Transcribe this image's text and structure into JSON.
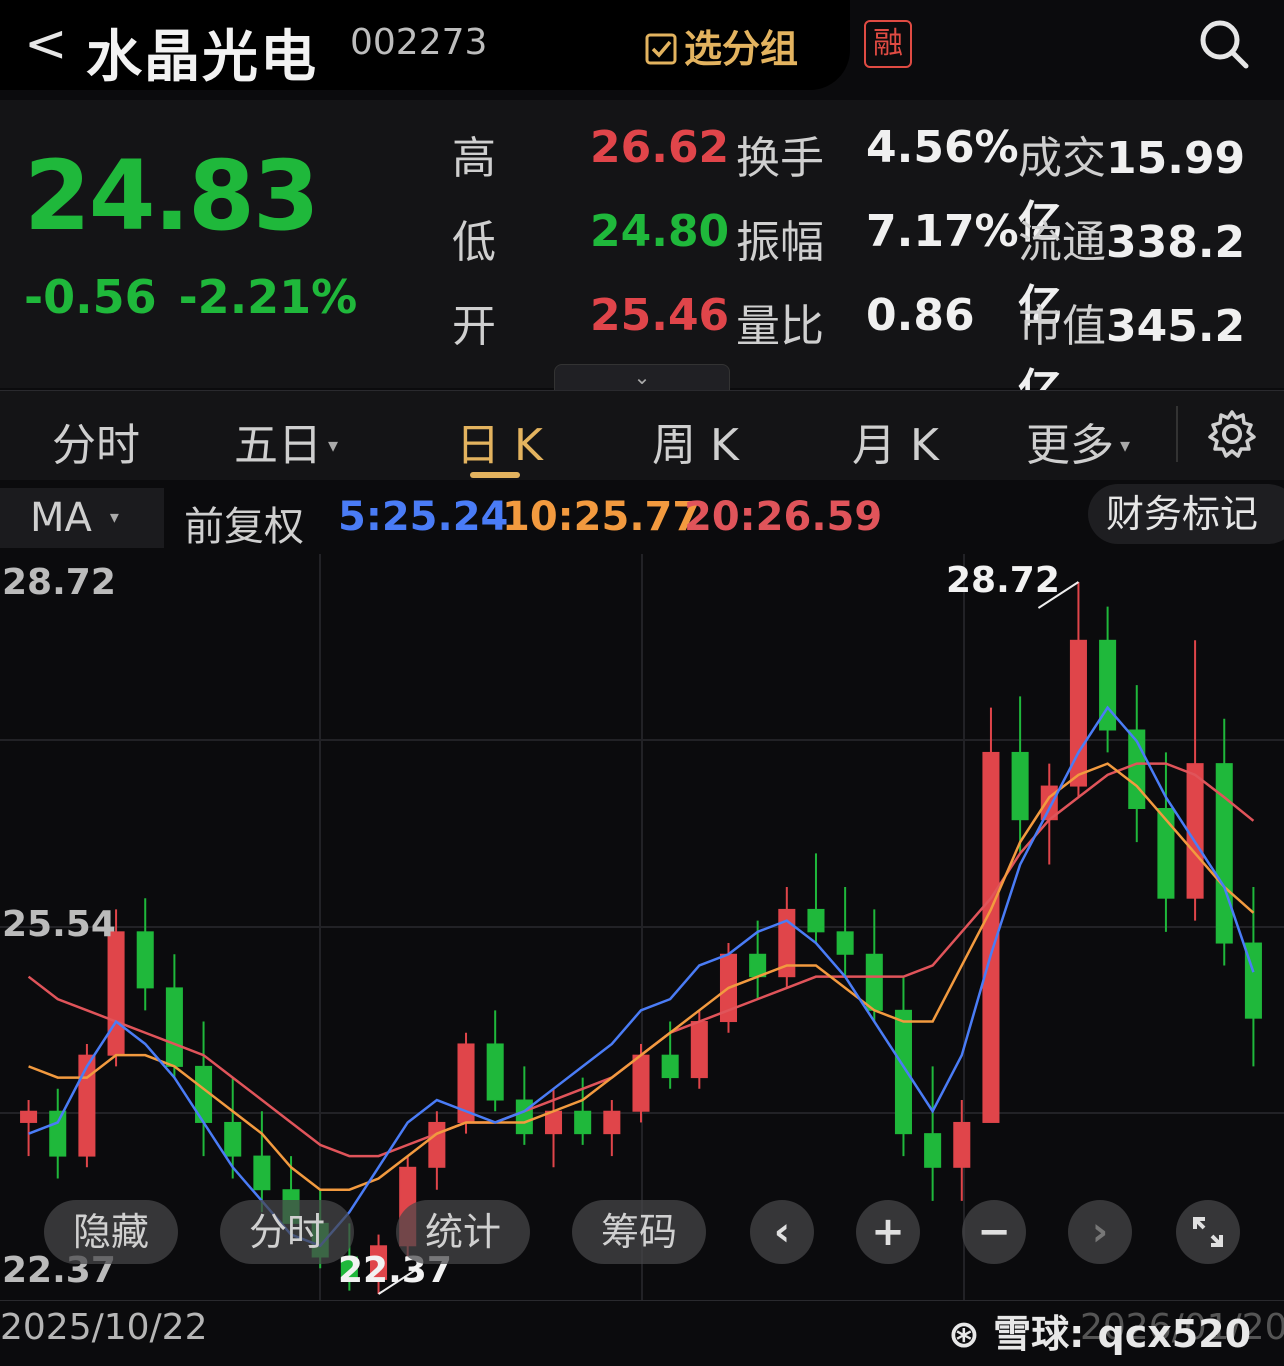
{
  "header": {
    "back_glyph": "<",
    "stock_name": "水晶光电",
    "stock_code": "002273",
    "pick_group": "选分组",
    "margin_badge": "融"
  },
  "quote": {
    "price": "24.83",
    "change": "-0.56",
    "change_pct": "-2.21%",
    "rows": [
      {
        "k1": "高",
        "v1": "26.62",
        "v1_color": "red",
        "k2": "换手",
        "v2": "4.56%",
        "k3": "成交",
        "v3": "15.99亿"
      },
      {
        "k1": "低",
        "v1": "24.80",
        "v1_color": "green",
        "k2": "振幅",
        "v2": "7.17%",
        "k3": "流通",
        "v3": "338.2亿"
      },
      {
        "k1": "开",
        "v1": "25.46",
        "v1_color": "red",
        "k2": "量比",
        "v2": "0.86",
        "k3": "市值",
        "v3": "345.2亿"
      }
    ]
  },
  "tabs": {
    "fenshi": "分时",
    "wuri": "五日",
    "rik": "日 K",
    "zhouk": "周 K",
    "yuek": "月 K",
    "more": "更多",
    "caret": "▾"
  },
  "ma_bar": {
    "select": "MA",
    "fuquan": "前复权",
    "ma5": "5:25.24",
    "ma10": "10:25.77",
    "ma20": "20:26.59",
    "fin_mark": "财务标记"
  },
  "chart_axis": {
    "y_top": "28.72",
    "y_mid": "25.54",
    "y_bottom": "22.37",
    "max_label": "28.72",
    "min_label": "22.37",
    "x_start": "2025/10/22"
  },
  "controls": {
    "hide": "隐藏",
    "fenshi": "分时",
    "stats": "统计",
    "chips": "筹码",
    "prev": "‹",
    "zoom_in": "+",
    "zoom_out": "−",
    "next": "›"
  },
  "watermark": {
    "text": "雪球: qcx520",
    "date_end": "2026/01/20"
  },
  "colors": {
    "up": "#e0454a",
    "down": "#1fb83b",
    "ma5": "#4a7cf6",
    "ma10": "#f29a3f",
    "ma20": "#e0545a",
    "accent": "#e3b35f"
  },
  "chart_data": {
    "type": "candlestick",
    "y_range": [
      22.37,
      28.72
    ],
    "x_start": "2025/10/22",
    "candles": [
      [
        23.9,
        24.1,
        23.6,
        24.0
      ],
      [
        24.0,
        24.2,
        23.4,
        23.6
      ],
      [
        23.6,
        24.6,
        23.5,
        24.5
      ],
      [
        24.5,
        25.8,
        24.4,
        25.6
      ],
      [
        25.6,
        25.9,
        24.9,
        25.1
      ],
      [
        25.1,
        25.4,
        24.3,
        24.4
      ],
      [
        24.4,
        24.8,
        23.6,
        23.9
      ],
      [
        23.9,
        24.3,
        23.4,
        23.6
      ],
      [
        23.6,
        24.0,
        23.1,
        23.3
      ],
      [
        23.3,
        23.6,
        22.9,
        23.0
      ],
      [
        23.0,
        23.3,
        22.6,
        22.7
      ],
      [
        22.7,
        23.0,
        22.4,
        22.5
      ],
      [
        22.5,
        22.9,
        22.37,
        22.8
      ],
      [
        22.8,
        23.6,
        22.7,
        23.5
      ],
      [
        23.5,
        24.0,
        23.3,
        23.9
      ],
      [
        23.9,
        24.7,
        23.8,
        24.6
      ],
      [
        24.6,
        24.9,
        24.0,
        24.1
      ],
      [
        24.1,
        24.4,
        23.7,
        23.8
      ],
      [
        23.8,
        24.2,
        23.5,
        24.0
      ],
      [
        24.0,
        24.3,
        23.7,
        23.8
      ],
      [
        23.8,
        24.1,
        23.6,
        24.0
      ],
      [
        24.0,
        24.6,
        23.9,
        24.5
      ],
      [
        24.5,
        24.8,
        24.2,
        24.3
      ],
      [
        24.3,
        24.9,
        24.2,
        24.8
      ],
      [
        24.8,
        25.5,
        24.7,
        25.4
      ],
      [
        25.4,
        25.7,
        25.0,
        25.2
      ],
      [
        25.2,
        26.0,
        25.1,
        25.8
      ],
      [
        25.8,
        26.3,
        25.5,
        25.6
      ],
      [
        25.6,
        26.0,
        25.2,
        25.4
      ],
      [
        25.4,
        25.8,
        24.8,
        24.9
      ],
      [
        24.9,
        25.2,
        23.6,
        23.8
      ],
      [
        23.8,
        24.4,
        23.2,
        23.5
      ],
      [
        23.5,
        24.1,
        23.2,
        23.9
      ],
      [
        23.9,
        27.6,
        23.9,
        27.2
      ],
      [
        27.2,
        27.7,
        26.3,
        26.6
      ],
      [
        26.6,
        27.1,
        26.2,
        26.9
      ],
      [
        26.9,
        28.72,
        26.8,
        28.2
      ],
      [
        28.2,
        28.5,
        27.2,
        27.4
      ],
      [
        27.4,
        27.8,
        26.4,
        26.7
      ],
      [
        26.7,
        27.2,
        25.6,
        25.9
      ],
      [
        25.9,
        28.2,
        25.7,
        27.1
      ],
      [
        27.1,
        27.5,
        25.3,
        25.5
      ],
      [
        25.5,
        26.0,
        24.4,
        24.83
      ]
    ],
    "ma5": [
      23.8,
      23.9,
      24.4,
      24.8,
      24.6,
      24.3,
      23.9,
      23.5,
      23.2,
      22.9,
      22.8,
      23.1,
      23.5,
      23.9,
      24.1,
      24.0,
      23.9,
      24.0,
      24.2,
      24.4,
      24.6,
      24.9,
      25.0,
      25.3,
      25.4,
      25.6,
      25.7,
      25.5,
      25.2,
      24.8,
      24.4,
      24.0,
      24.5,
      25.4,
      26.2,
      26.7,
      27.2,
      27.6,
      27.3,
      26.8,
      26.4,
      26.0,
      25.24
    ],
    "ma10": [
      24.4,
      24.3,
      24.3,
      24.5,
      24.5,
      24.4,
      24.2,
      24.0,
      23.8,
      23.5,
      23.3,
      23.3,
      23.4,
      23.6,
      23.8,
      23.9,
      23.9,
      23.9,
      24.0,
      24.1,
      24.3,
      24.5,
      24.7,
      24.9,
      25.1,
      25.2,
      25.3,
      25.3,
      25.1,
      24.9,
      24.8,
      24.8,
      25.3,
      25.8,
      26.4,
      26.8,
      27.0,
      27.1,
      26.9,
      26.6,
      26.3,
      26.0,
      25.77
    ],
    "ma20": [
      25.2,
      25.0,
      24.9,
      24.8,
      24.7,
      24.6,
      24.5,
      24.3,
      24.1,
      23.9,
      23.7,
      23.6,
      23.6,
      23.7,
      23.8,
      23.9,
      23.9,
      24.0,
      24.1,
      24.2,
      24.3,
      24.5,
      24.7,
      24.8,
      24.9,
      25.0,
      25.1,
      25.2,
      25.2,
      25.2,
      25.2,
      25.3,
      25.6,
      25.9,
      26.3,
      26.6,
      26.8,
      27.0,
      27.1,
      27.1,
      27.0,
      26.8,
      26.59
    ]
  }
}
